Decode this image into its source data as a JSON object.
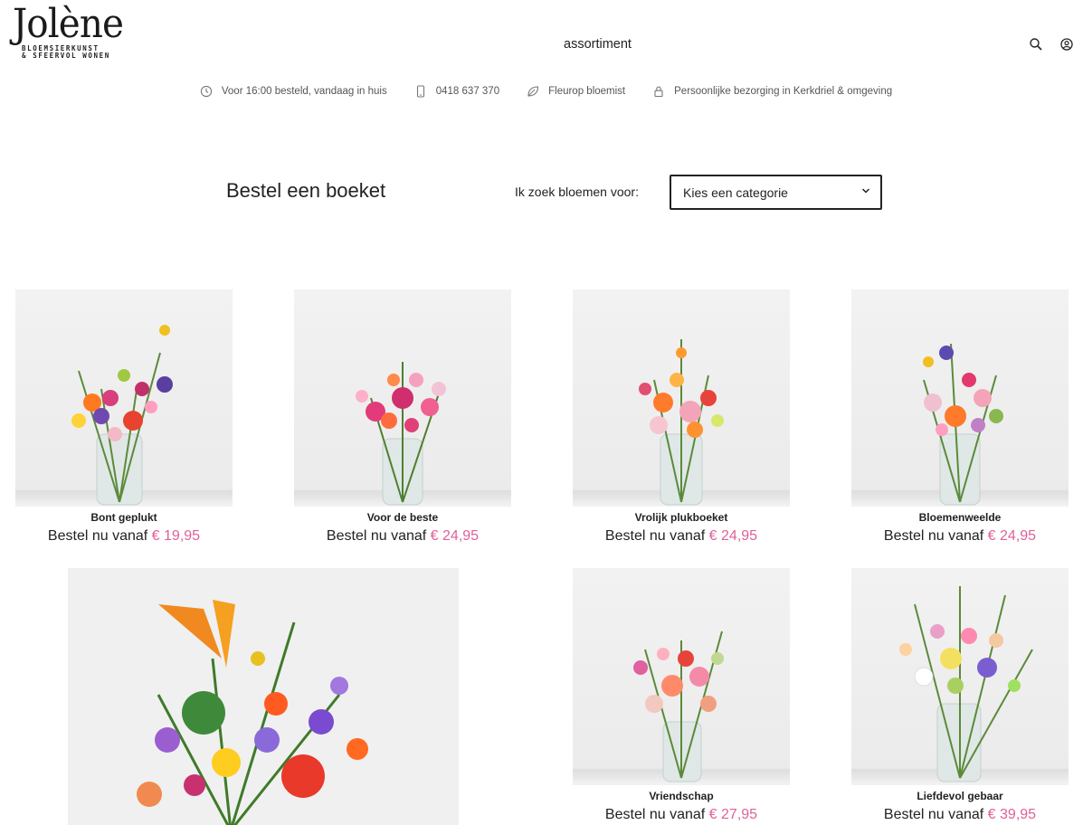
{
  "brand": {
    "name": "Jolène",
    "tagline_1": "BLOEMSIERKUNST",
    "tagline_2": "& SFEERVOL WONEN"
  },
  "nav": {
    "assortiment": "assortiment"
  },
  "usps": [
    {
      "icon": "clock-icon",
      "text": "Voor 16:00 besteld, vandaag in huis"
    },
    {
      "icon": "phone-icon",
      "text": "0418 637 370"
    },
    {
      "icon": "leaf-icon",
      "text": "Fleurop bloemist"
    },
    {
      "icon": "lock-icon",
      "text": "Persoonlijke bezorging in Kerkdriel & omgeving"
    }
  ],
  "filter": {
    "title": "Bestel een boeket",
    "label": "Ik zoek bloemen voor:",
    "selected": "Kies een categorie"
  },
  "price_prefix": "Bestel nu vanaf",
  "products": [
    {
      "name": "Bont geplukt",
      "price": "€ 19,95"
    },
    {
      "name": "Voor de beste",
      "price": "€ 24,95"
    },
    {
      "name": "Vrolijk plukboeket",
      "price": "€ 24,95"
    },
    {
      "name": "Bloemenweelde",
      "price": "€ 24,95"
    },
    {
      "name": "Vriendschap",
      "price": "€ 27,95"
    },
    {
      "name": "Liefdevol gebaar",
      "price": "€ 39,95"
    }
  ],
  "colors": {
    "price_accent": "#e0609a",
    "text": "#222222"
  }
}
